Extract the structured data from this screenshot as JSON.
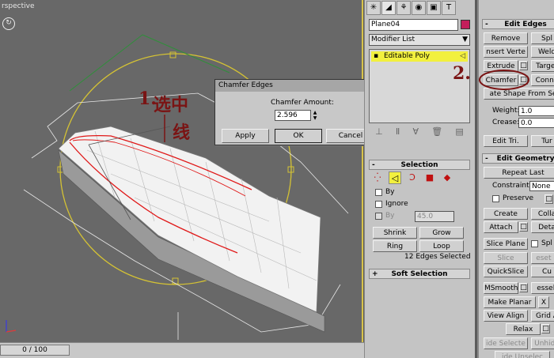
{
  "viewport": {
    "label": "rspective",
    "timeline": "0 / 100"
  },
  "annotations": {
    "step1": "1.",
    "step1_text_a": "选中",
    "step1_text_b": "线",
    "step2": "2."
  },
  "dialog": {
    "title": "Chamfer Edges",
    "amount_label": "Chamfer Amount:",
    "amount_value": "2.596",
    "apply": "Apply",
    "ok": "OK",
    "cancel": "Cancel"
  },
  "panel": {
    "object_name": "Plane04",
    "object_color": "#c41e5b",
    "modifier_list": "Modifier List",
    "stack_item": "Editable Poly",
    "selection": {
      "title": "Selection",
      "by_vertex": "By",
      "ignore": "Ignore",
      "by_angle": "By",
      "angle_value": "45.0",
      "shrink": "Shrink",
      "grow": "Grow",
      "ring": "Ring",
      "loop": "Loop",
      "status": "12 Edges Selected"
    },
    "soft_selection": "Soft Selection"
  },
  "edit_edges": {
    "title": "Edit Edges",
    "remove": "Remove",
    "split": "Spl",
    "insert_vertex": "nsert Verte",
    "weld": "Weld",
    "extrude": "Extrude",
    "target_weld": "Target",
    "chamfer": "Chamfer",
    "connect": "Conne",
    "create_shape": "ate Shape From Se",
    "weight_label": "Weight:",
    "weight_value": "1.0",
    "crease_label": "Crease:",
    "crease_value": "0.0",
    "edit_tri": "Edit Tri.",
    "turn": "Tur"
  },
  "edit_geometry": {
    "title": "Edit Geometry",
    "repeat_last": "Repeat Last",
    "constraints_label": "Constraints:",
    "constraints_value": "None",
    "preserve": "Preserve",
    "create": "Create",
    "collapse": "Colla",
    "attach": "Attach",
    "detach": "Deta",
    "slice_plane": "Slice Plane",
    "split": "Spl",
    "slice": "Slice",
    "reset_plane": "eset P",
    "quickslice": "QuickSlice",
    "cut": "Cu",
    "msmooth": "MSmooth",
    "tessellate": "essell",
    "make_planar": "Make Planar",
    "x": "X",
    "view_align": "View Align",
    "grid_align": "Grid A",
    "relax": "Relax",
    "hide_selected": "ide Selecte",
    "unhide": "Unhide",
    "hide_unselected": "ide Unselec"
  },
  "colors": {
    "viewport_bg": "#686868",
    "panel_bg": "#c4c4c4",
    "selection_yellow": "#f2f03e",
    "annotation": "#7a1414",
    "edge_selected": "#e01818"
  }
}
